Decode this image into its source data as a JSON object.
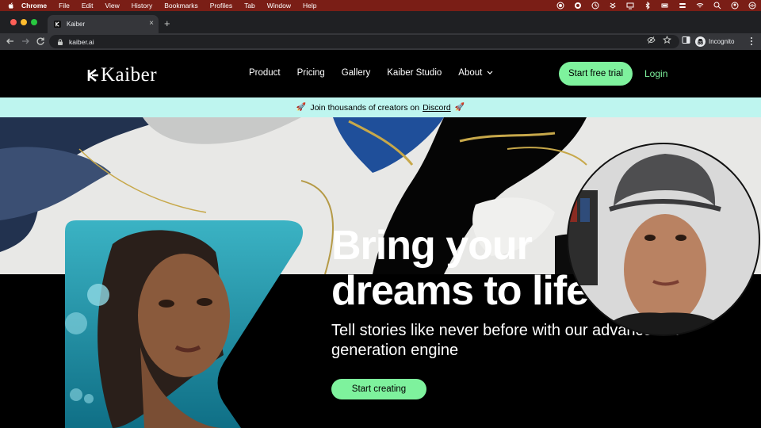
{
  "menubar": {
    "app_name": "Chrome",
    "items": [
      "File",
      "Edit",
      "View",
      "History",
      "Bookmarks",
      "Profiles",
      "Tab",
      "Window",
      "Help"
    ]
  },
  "browser": {
    "tab_title": "Kaiber",
    "new_tab_symbol": "+",
    "close_symbol": "×",
    "url": "kaiber.ai",
    "profile_label": "Incognito"
  },
  "site": {
    "logo_text": "Kaiber",
    "nav": {
      "product": "Product",
      "pricing": "Pricing",
      "gallery": "Gallery",
      "studio": "Kaiber Studio",
      "about": "About"
    },
    "start_free_trial": "Start free trial",
    "login": "Login",
    "banner": {
      "rocket_left": "🚀",
      "text": "Join thousands of creators on",
      "link": "Discord",
      "rocket_right": "🚀"
    },
    "hero": {
      "headline_line1": "Bring your",
      "headline_line2": "dreams to life",
      "subhead": "Tell stories like never before with our advanced AI generation engine",
      "cta": "Start creating"
    }
  },
  "colors": {
    "accent_green": "#7ef29d",
    "banner_bg": "#bef5ef",
    "menubar_bg": "#7a1e16"
  },
  "icons": [
    "apple-icon",
    "back-icon",
    "forward-icon",
    "reload-icon",
    "lock-icon",
    "eye-off-icon",
    "star-icon",
    "sidebar-icon",
    "kebab-icon",
    "chevron-down-icon",
    "kaiber-logo-icon"
  ]
}
